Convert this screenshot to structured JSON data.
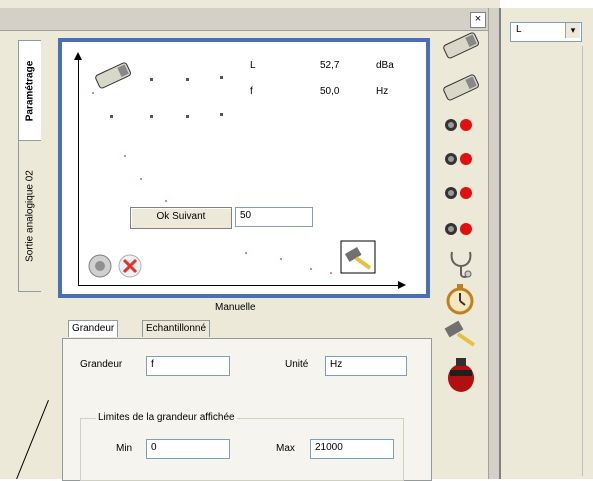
{
  "window": {
    "close_glyph": "×"
  },
  "side_tabs": [
    "Paramétrage",
    "Sortie analogique 02"
  ],
  "graph": {
    "readout": [
      {
        "name": "L",
        "value": "52,7",
        "unit": "dBa"
      },
      {
        "name": "f",
        "value": "50,0",
        "unit": "Hz"
      }
    ],
    "ok_button": "Ok Suivant",
    "entry_value": "50",
    "mode_label": "Manuelle"
  },
  "tabs": [
    "Grandeur",
    "Echantillonné"
  ],
  "form": {
    "grandeur_label": "Grandeur",
    "grandeur_value": "f",
    "unite_label": "Unité",
    "unite_value": "Hz",
    "group_title": "Limites de la grandeur affichée",
    "min_label": "Min",
    "min_value": "0",
    "max_label": "Max",
    "max_value": "21000"
  },
  "right_panel": {
    "combo_value": "L",
    "combo_arrow": "▾"
  },
  "icons": {
    "toolbar": [
      "sensor-icon",
      "sensor-icon",
      "red-led-icon",
      "red-led-icon",
      "red-led-icon",
      "red-led-icon",
      "stethoscope-icon",
      "stopwatch-icon",
      "hammer-icon",
      "fire-extinguisher-icon"
    ],
    "graph": [
      "sensor-icon",
      "record-icon",
      "delete-icon",
      "hammer-icon"
    ]
  },
  "colors": {
    "graph_border": "#4a6fb5",
    "led_red": "#e01010",
    "delete_red": "#e03030"
  }
}
